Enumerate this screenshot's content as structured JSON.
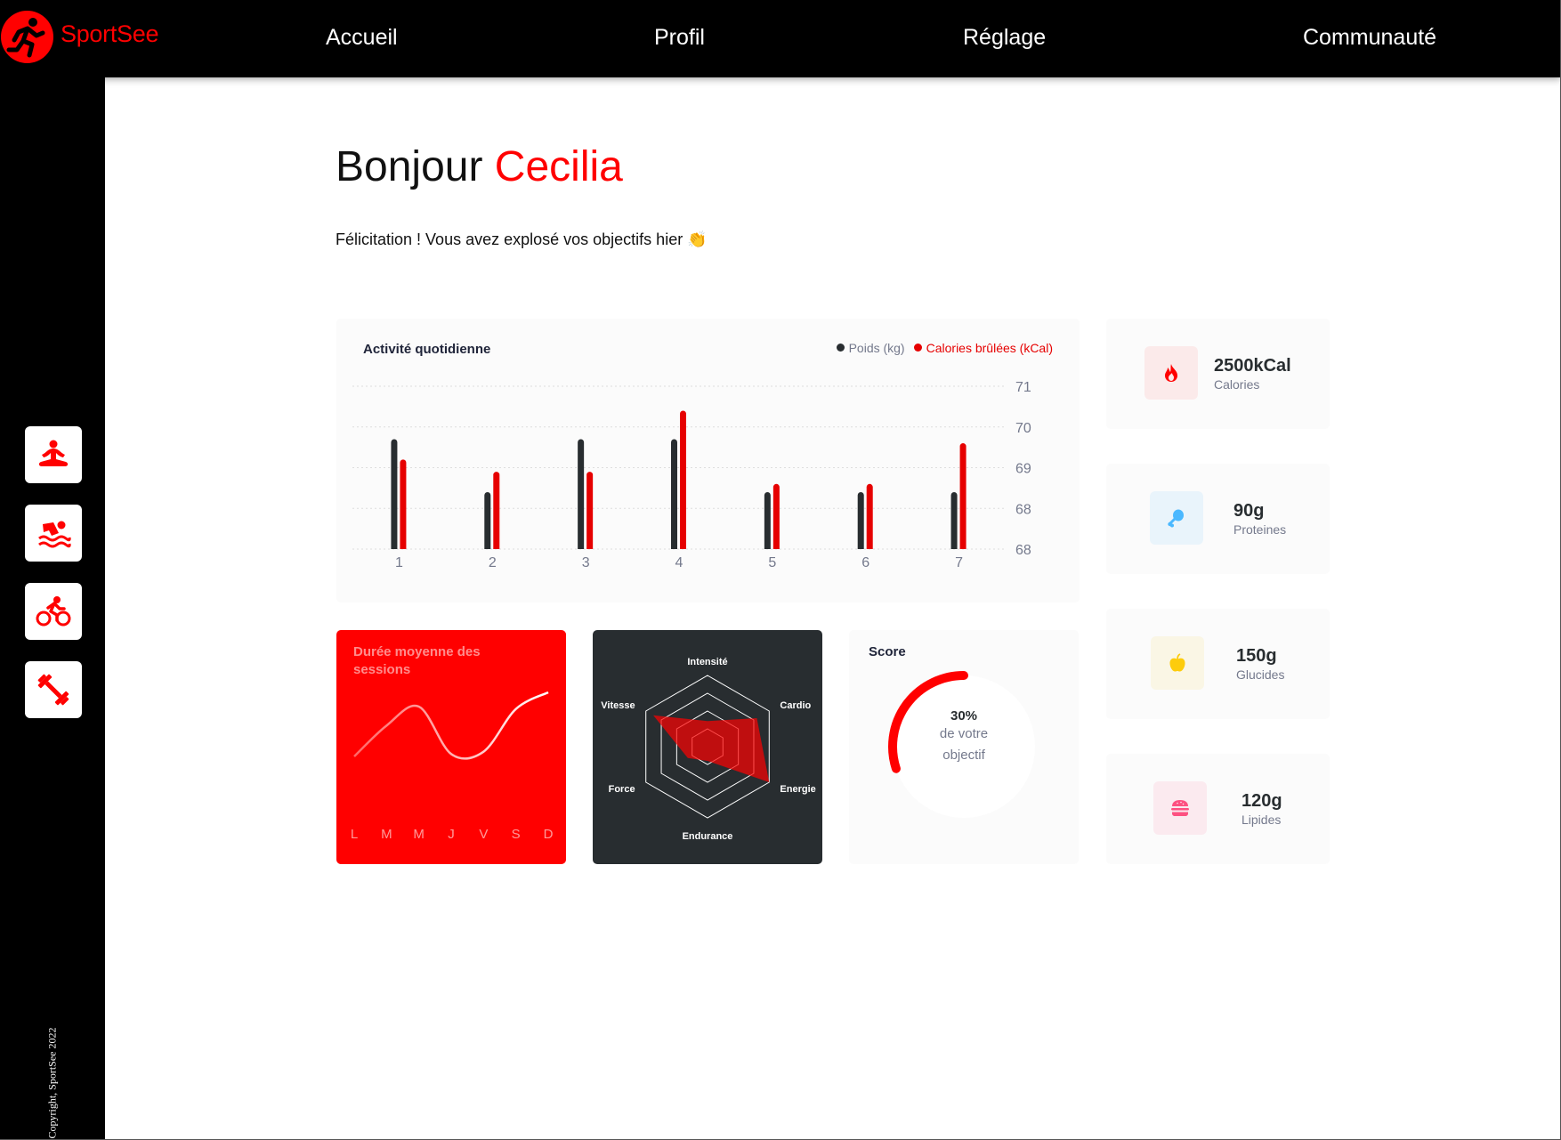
{
  "app": {
    "logo_text": "SportSee",
    "brand_color": "#ff0101",
    "copyright": "Copyright, SportSee 2022"
  },
  "nav": {
    "items": [
      {
        "label": "Accueil"
      },
      {
        "label": "Profil"
      },
      {
        "label": "Réglage"
      },
      {
        "label": "Communauté"
      }
    ]
  },
  "sidebar": {
    "icons": [
      "meditation-icon",
      "swimming-icon",
      "cycling-icon",
      "dumbbell-icon"
    ]
  },
  "greeting": {
    "hello": "Bonjour",
    "name": "Cecilia",
    "message": "Félicitation ! Vous avez explosé vos objectifs hier 👏"
  },
  "activity": {
    "title": "Activité quotidienne",
    "legend_weight": "Poids (kg)",
    "legend_calories": "Calories brûlées (kCal)"
  },
  "sessions": {
    "title": "Durée moyenne des sessions",
    "days": [
      "L",
      "M",
      "M",
      "J",
      "V",
      "S",
      "D"
    ]
  },
  "performance": {
    "labels": [
      "Intensité",
      "Cardio",
      "Energie",
      "Endurance",
      "Force",
      "Vitesse"
    ]
  },
  "score": {
    "title": "Score",
    "percent": "30%",
    "line1": "de votre",
    "line2": "objectif",
    "value": 0.3
  },
  "key_data": [
    {
      "value": "2500kCal",
      "label": "Calories",
      "icon": "fire-icon",
      "bg": "#fbeaea",
      "color": "#ff0000"
    },
    {
      "value": "90g",
      "label": "Proteines",
      "icon": "chicken-icon",
      "bg": "#e9f4fb",
      "color": "#4ab8ff"
    },
    {
      "value": "150g",
      "label": "Glucides",
      "icon": "apple-icon",
      "bg": "#faf6e5",
      "color": "#fdcc0c"
    },
    {
      "value": "120g",
      "label": "Lipides",
      "icon": "burger-icon",
      "bg": "#fbeaef",
      "color": "#fd5181"
    }
  ],
  "chart_data": [
    {
      "type": "bar",
      "title": "Activité quotidienne",
      "categories": [
        "1",
        "2",
        "3",
        "4",
        "5",
        "6",
        "7"
      ],
      "series": [
        {
          "name": "Poids (kg)",
          "color": "#282d30",
          "values": [
            69.7,
            68.4,
            69.7,
            69.7,
            68.4,
            68.4,
            68.4
          ]
        },
        {
          "name": "Calories brûlées (kCal)",
          "color": "#e60000",
          "values": [
            69.2,
            68.9,
            68.9,
            70.4,
            68.6,
            68.6,
            69.6
          ]
        }
      ],
      "y_ticks": [
        "71",
        "70",
        "69",
        "68",
        "68"
      ],
      "y_tick_values": [
        71,
        70,
        69,
        68,
        67
      ],
      "ylim": [
        67,
        71
      ],
      "grid": true,
      "legend_position": "top-right"
    },
    {
      "type": "line",
      "title": "Durée moyenne des sessions",
      "categories": [
        "L",
        "M",
        "M",
        "J",
        "V",
        "S",
        "D"
      ],
      "values": [
        18,
        31,
        39,
        19,
        20,
        38,
        45
      ],
      "ylim": [
        0,
        60
      ]
    },
    {
      "type": "radar",
      "axes": [
        "Intensité",
        "Cardio",
        "Energie",
        "Endurance",
        "Force",
        "Vitesse"
      ],
      "values": [
        90,
        200,
        250,
        50,
        80,
        220
      ],
      "max": 250
    },
    {
      "type": "radial",
      "title": "Score",
      "value": 0.3
    }
  ]
}
